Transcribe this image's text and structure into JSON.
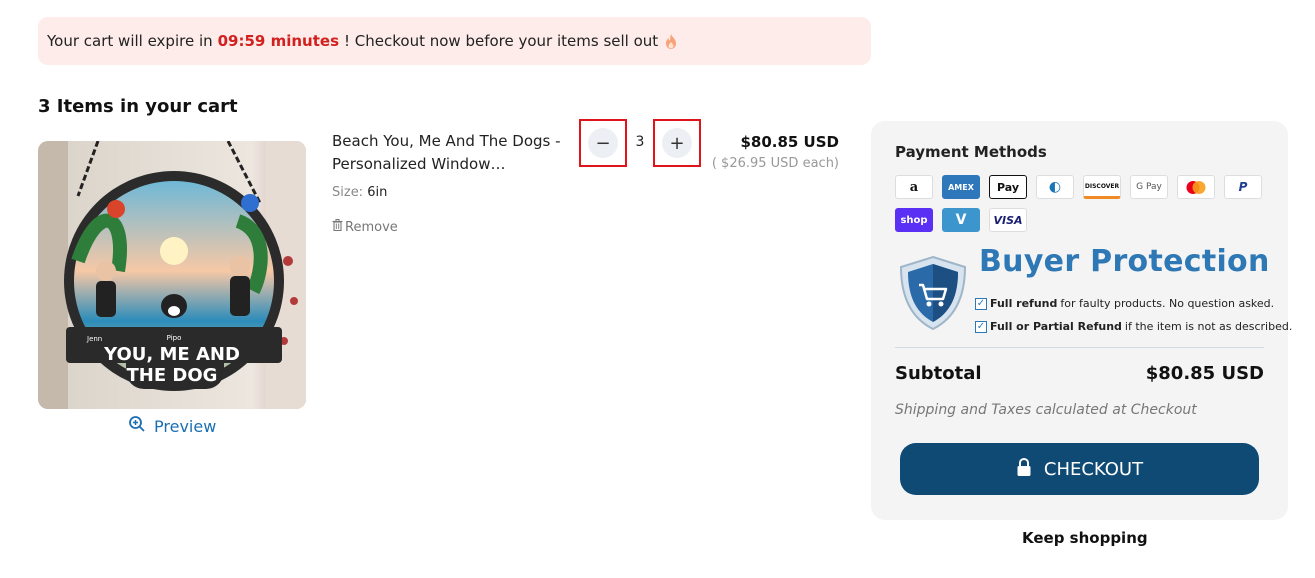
{
  "banner": {
    "prefix": "Your cart will expire in",
    "timer": "09:59 minutes",
    "suffix": "! Checkout now before your items sell out"
  },
  "cart": {
    "title": "3 Items in your cart",
    "preview_label": "Preview",
    "item": {
      "name": "Beach You, Me And The Dogs - Personalized Window Hanging...",
      "size_label": "Size:",
      "size_value": "6in",
      "remove_label": "Remove",
      "quantity": "3",
      "minus_symbol": "−",
      "plus_symbol": "+",
      "price": "$80.85 USD",
      "each_price": "( $26.95 USD each)",
      "image_text": {
        "headline_1": "YOU, ME AND",
        "headline_2": "THE DOG",
        "name_left": "Jenn",
        "name_right": "Pipo"
      }
    }
  },
  "summary": {
    "payment_methods_title": "Payment Methods",
    "payment_methods": [
      {
        "icon": "amazon-pay-icon",
        "label": "a"
      },
      {
        "icon": "amex-icon",
        "label": "AMEX"
      },
      {
        "icon": "apple-pay-icon",
        "label": "Pay"
      },
      {
        "icon": "diners-club-icon",
        "label": "◐"
      },
      {
        "icon": "discover-icon",
        "label": "DISCOVER"
      },
      {
        "icon": "google-pay-icon",
        "label": "G Pay"
      },
      {
        "icon": "mastercard-icon",
        "label": ""
      },
      {
        "icon": "paypal-icon",
        "label": "P"
      },
      {
        "icon": "shop-pay-icon",
        "label": "shop"
      },
      {
        "icon": "venmo-icon",
        "label": "V"
      },
      {
        "icon": "visa-icon",
        "label": "VISA"
      }
    ],
    "buyer_protection": {
      "title": "Buyer Protection",
      "line1_bold": "Full refund",
      "line1_rest": "for faulty products. No question asked.",
      "line2_bold": "Full or Partial Refund",
      "line2_rest": "if the item is not as described."
    },
    "subtotal_label": "Subtotal",
    "subtotal_value": "$80.85 USD",
    "shipping_note": "Shipping and Taxes calculated at Checkout",
    "checkout_label": "CHECKOUT"
  },
  "keep_shopping_label": "Keep shopping",
  "colors": {
    "accent": "#0f4a74",
    "timer": "#d3201e",
    "banner_bg": "#fdecea",
    "highlight_box": "#e0141b",
    "protection_blue": "#2e78b5"
  }
}
